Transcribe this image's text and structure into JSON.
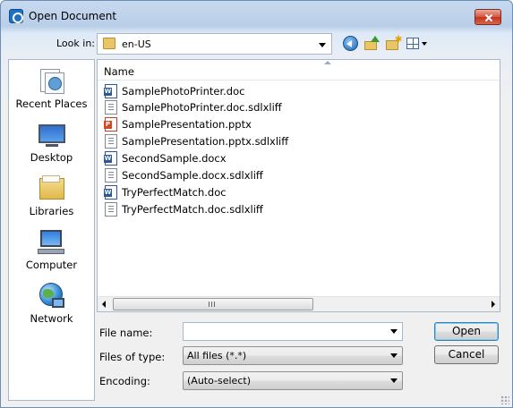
{
  "window": {
    "title": "Open Document"
  },
  "toolbar": {
    "look_in_label": "Look in:",
    "look_in_value": "en-US"
  },
  "places": [
    {
      "label": "Recent Places",
      "icon": "recent-places-icon"
    },
    {
      "label": "Desktop",
      "icon": "desktop-icon"
    },
    {
      "label": "Libraries",
      "icon": "libraries-icon"
    },
    {
      "label": "Computer",
      "icon": "computer-icon"
    },
    {
      "label": "Network",
      "icon": "network-icon"
    }
  ],
  "file_list": {
    "column_header": "Name",
    "files": [
      {
        "name": "SamplePhotoPrinter.doc",
        "type": "word"
      },
      {
        "name": "SamplePhotoPrinter.doc.sdlxliff",
        "type": "xliff"
      },
      {
        "name": "SamplePresentation.pptx",
        "type": "ppt"
      },
      {
        "name": "SamplePresentation.pptx.sdlxliff",
        "type": "xliff"
      },
      {
        "name": "SecondSample.docx",
        "type": "word"
      },
      {
        "name": "SecondSample.docx.sdlxliff",
        "type": "xliff"
      },
      {
        "name": "TryPerfectMatch.doc",
        "type": "word"
      },
      {
        "name": "TryPerfectMatch.doc.sdlxliff",
        "type": "xliff"
      }
    ]
  },
  "form": {
    "file_name_label": "File name:",
    "file_name_value": "",
    "files_of_type_label": "Files of type:",
    "files_of_type_value": "All files (*.*)",
    "encoding_label": "Encoding:",
    "encoding_value": "(Auto-select)"
  },
  "buttons": {
    "open": "Open",
    "cancel": "Cancel"
  }
}
